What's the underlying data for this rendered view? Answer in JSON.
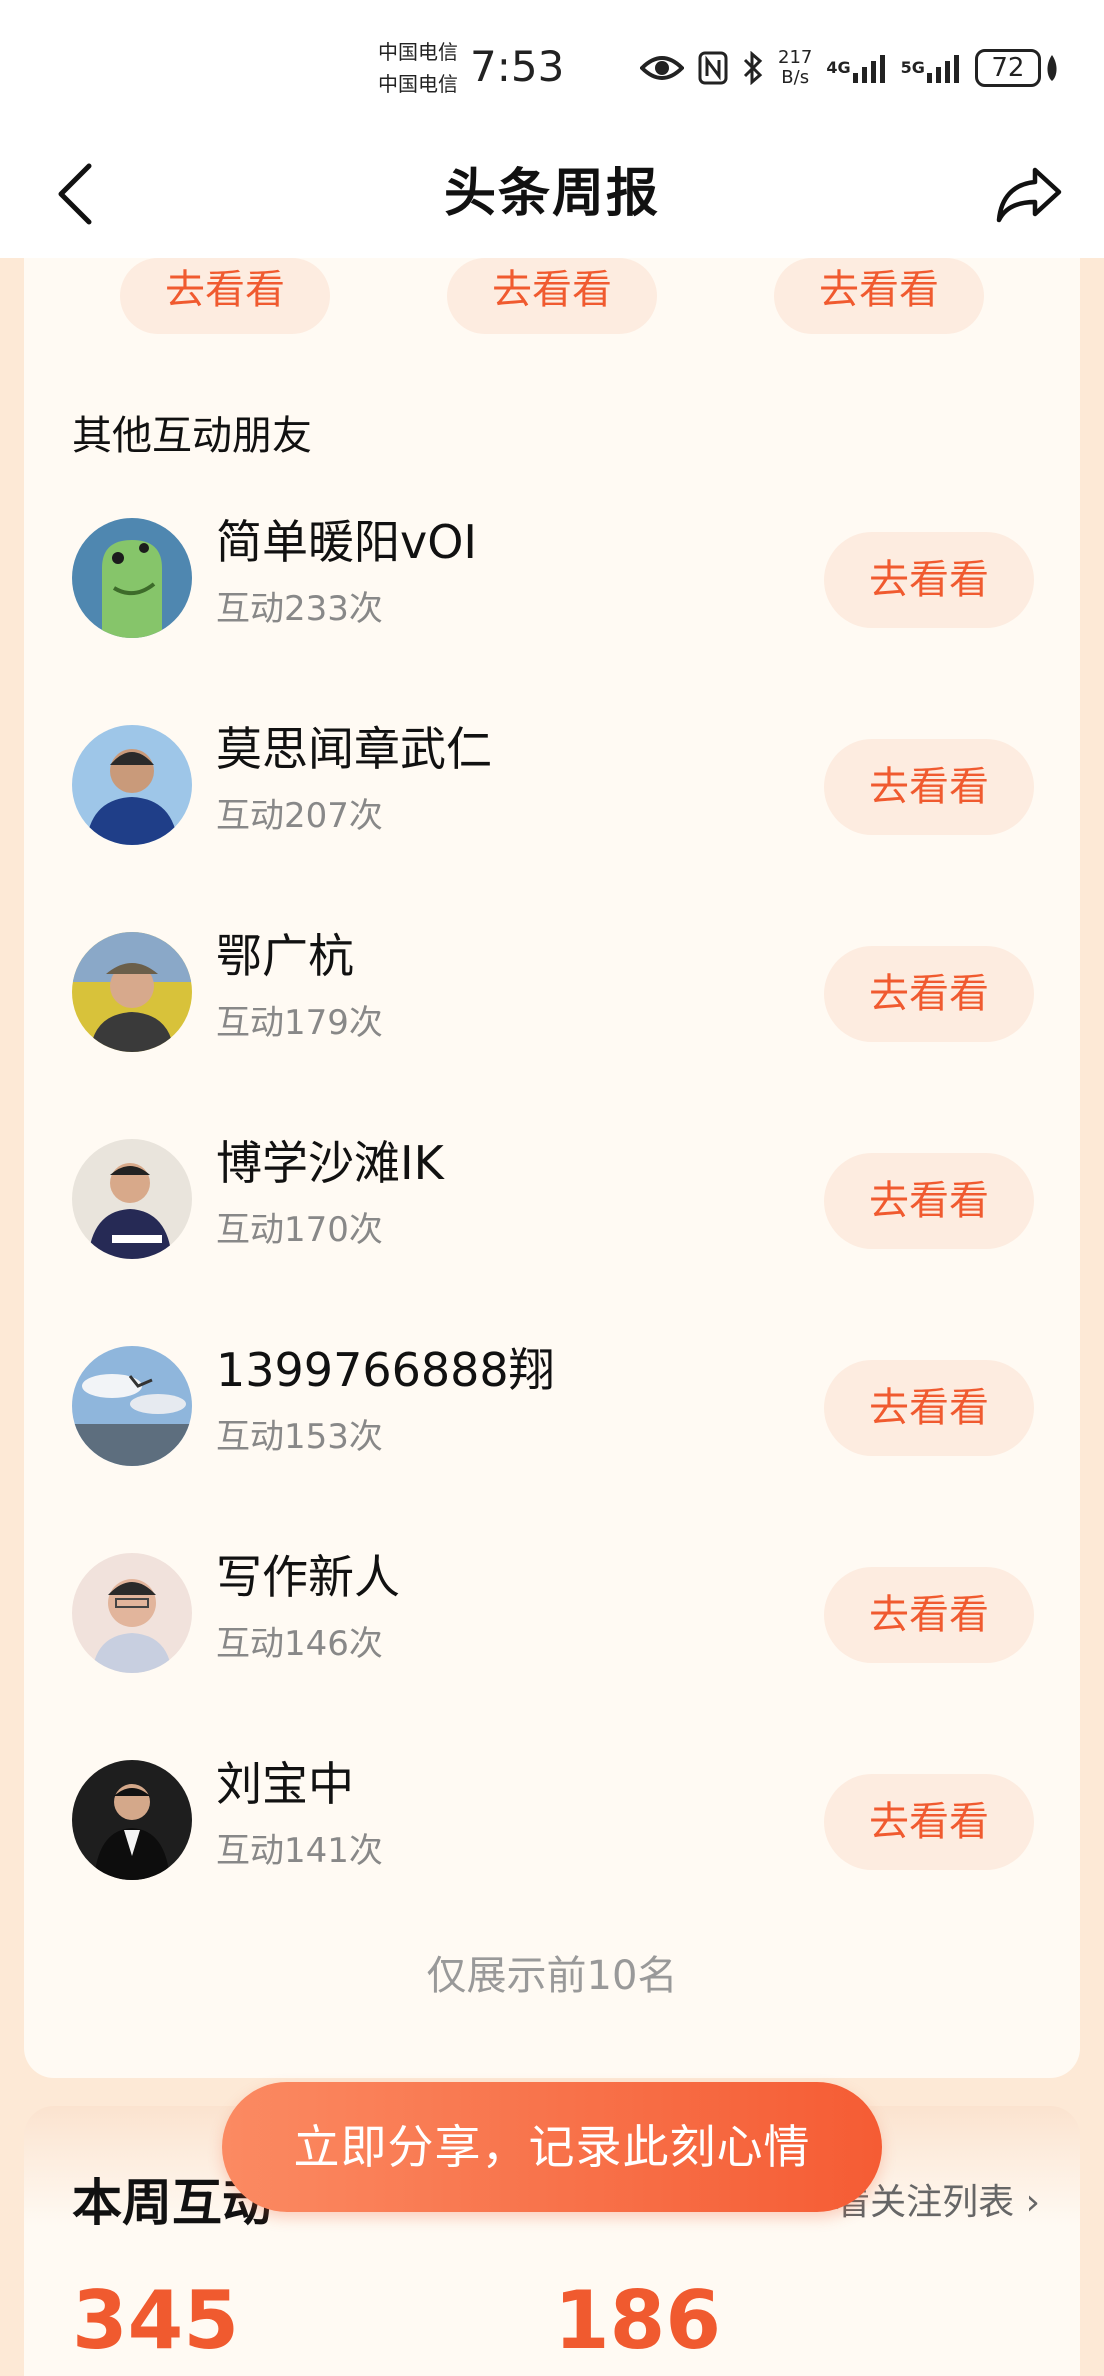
{
  "status_bar": {
    "carrier_1": "中国电信",
    "carrier_2": "中国电信",
    "time": "7:53",
    "net_speed_value": "217",
    "net_speed_unit": "B/s",
    "signal_1_label": "4G",
    "signal_2_label": "5G",
    "battery": "72"
  },
  "header": {
    "title": "头条周报"
  },
  "top_row": {
    "buttons": [
      "去看看",
      "去看看",
      "去看看"
    ]
  },
  "section_title": "其他互动朋友",
  "friends": [
    {
      "name": "简单暖阳vOI",
      "count": "互动233次",
      "button": "去看看"
    },
    {
      "name": "莫思闻章武仁",
      "count": "互动207次",
      "button": "去看看"
    },
    {
      "name": "鄂广杭",
      "count": "互动179次",
      "button": "去看看"
    },
    {
      "name": "博学沙滩IK",
      "count": "互动170次",
      "button": "去看看"
    },
    {
      "name": "1399766888翔",
      "count": "互动153次",
      "button": "去看看"
    },
    {
      "name": "写作新人",
      "count": "互动146次",
      "button": "去看看"
    },
    {
      "name": "刘宝中",
      "count": "互动141次",
      "button": "去看看"
    }
  ],
  "footnote": "仅展示前10名",
  "summary": {
    "title": "本周互动",
    "link": "看关注列表",
    "stat_1": "345",
    "stat_2": "186"
  },
  "share_button": "立即分享，记录此刻心情",
  "colors": {
    "accent": "#f05a2f",
    "button_bg": "#fdece0",
    "card_bg": "#fffaf3",
    "page_bg": "#fde9d6"
  }
}
